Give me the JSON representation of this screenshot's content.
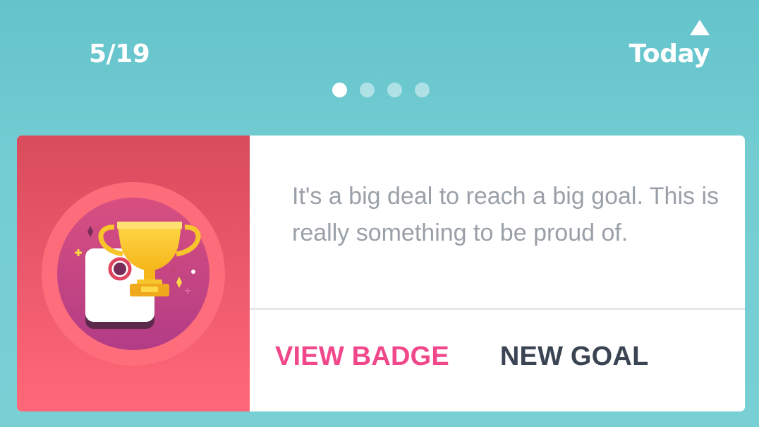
{
  "header": {
    "date_label": "5/19",
    "today_label": "Today",
    "today_icon": "triangle-up-icon",
    "pager": {
      "total": 4,
      "active_index": 0
    }
  },
  "card": {
    "badge_icon": "trophy-badge-icon",
    "message": "It's a big deal to reach a big goal. This is really something to be proud of.",
    "actions": {
      "view_badge_label": "VIEW BADGE",
      "new_goal_label": "NEW GOAL"
    }
  },
  "colors": {
    "background": "#74cdd3",
    "card_art": "#ee5a6e",
    "accent_pink": "#f0488a",
    "text_dark": "#3b4452",
    "text_muted": "#9aa0a8"
  }
}
